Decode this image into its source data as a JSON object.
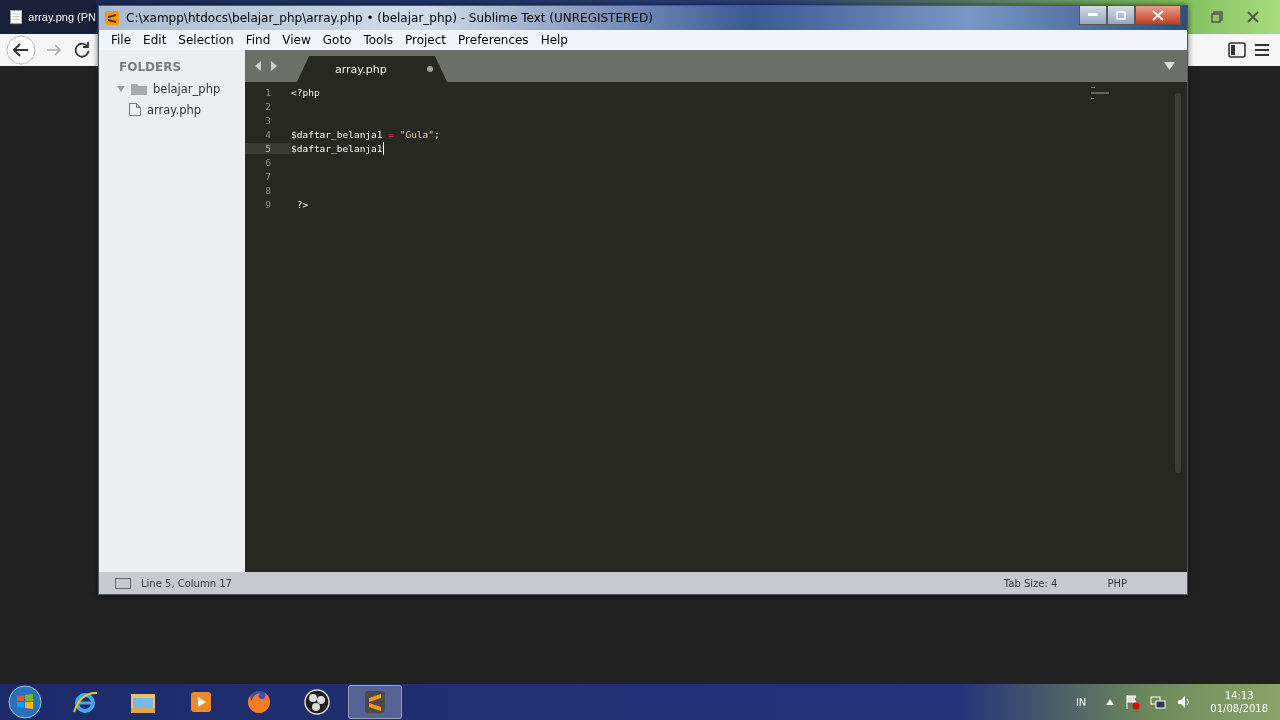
{
  "browser": {
    "tab_title": "array.png (PN"
  },
  "editor": {
    "title": "C:\\xampp\\htdocs\\belajar_php\\array.php • (belajar_php) - Sublime Text (UNREGISTERED)",
    "menu": [
      "File",
      "Edit",
      "Selection",
      "Find",
      "View",
      "Goto",
      "Tools",
      "Project",
      "Preferences",
      "Help"
    ],
    "sidebar": {
      "heading": "FOLDERS",
      "tree": [
        {
          "label": "belajar_php",
          "expanded": true,
          "children": [
            {
              "label": "array.php"
            }
          ]
        }
      ]
    },
    "tabs": [
      {
        "label": "array.php",
        "selected": true,
        "modified": true
      }
    ],
    "lines": [
      {
        "number": "1",
        "current": false,
        "tokens": [
          {
            "kind": "plain",
            "text": "<?php"
          }
        ]
      },
      {
        "number": "2",
        "current": false
      },
      {
        "number": "3",
        "current": false
      },
      {
        "number": "4",
        "current": false,
        "tokens": [
          {
            "kind": "plain",
            "text": "$daftar_belanja1 "
          },
          {
            "kind": "operator",
            "text": "="
          },
          {
            "kind": "string",
            "text": " \"Gula\""
          },
          {
            "kind": "plain",
            "text": ";"
          }
        ]
      },
      {
        "number": "5",
        "current": true,
        "tokens": [
          {
            "kind": "plain",
            "text": "$daftar_belanja1"
          }
        ]
      },
      {
        "number": "6",
        "current": false
      },
      {
        "number": "7",
        "current": false
      },
      {
        "number": "8",
        "current": false
      },
      {
        "number": "9",
        "current": false,
        "tokens": [
          {
            "kind": "plain",
            "text": " ?>"
          }
        ]
      }
    ],
    "status_bar": {
      "position": "Line 5, Column 17",
      "tab_size": "Tab Size: 4",
      "syntax": "PHP"
    }
  },
  "taskbar": {
    "apps": [
      {
        "kind": "ie",
        "active": false
      },
      {
        "kind": "folder",
        "active": false
      },
      {
        "kind": "media",
        "active": false
      },
      {
        "kind": "firefox",
        "active": false
      },
      {
        "kind": "obs",
        "active": false
      },
      {
        "kind": "sublime",
        "active": true
      }
    ],
    "tray": {
      "language": "IN",
      "time": "14:13",
      "date": "01/08/2018"
    }
  }
}
